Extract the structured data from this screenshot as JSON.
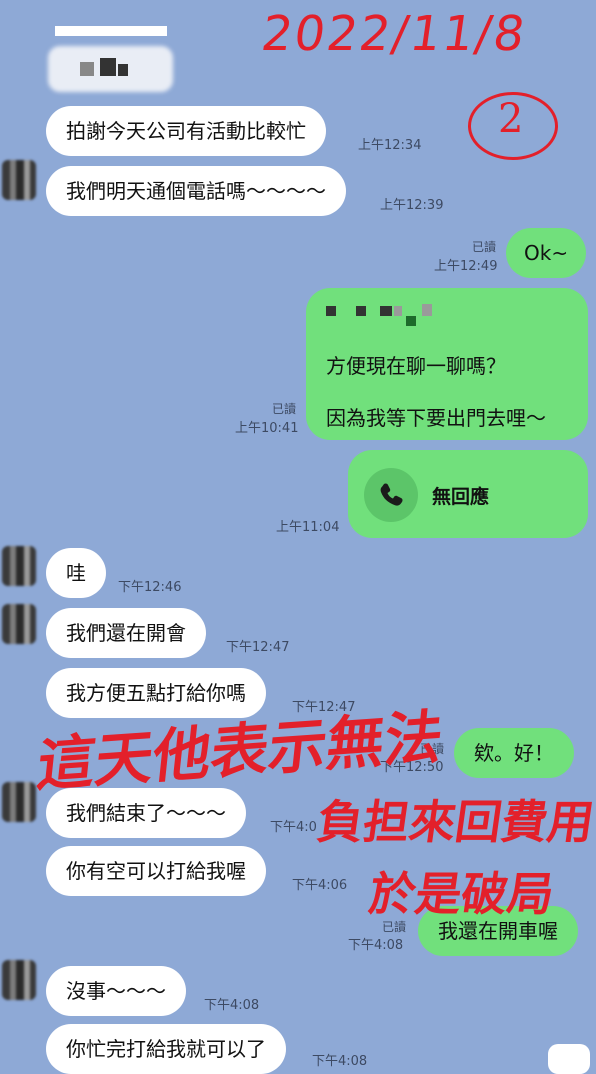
{
  "header": {
    "handwritten_date": "2022/11/8",
    "circled_number": "2"
  },
  "messages": [
    {
      "text": "拍謝今天公司有活動比較忙",
      "time": "上午12:34"
    },
    {
      "text": "我們明天通個電話嗎～～～～",
      "time": "上午12:39"
    },
    {
      "text": "Ok~",
      "time": "上午12:49",
      "read": "已讀"
    },
    {
      "text_line1": "方便現在聊一聊嗎？",
      "text_line2": "因為我等下要出門去哩～",
      "time": "上午10:41",
      "read": "已讀"
    },
    {
      "text": "無回應",
      "time": "上午11:04",
      "icon": "phone-icon"
    },
    {
      "text": "哇",
      "time": "下午12:46"
    },
    {
      "text": "我們還在開會",
      "time": "下午12:47"
    },
    {
      "text": "我方便五點打給你嗎",
      "time": "下午12:47"
    },
    {
      "text": "欸。好！",
      "time": "下午12:50",
      "read": "已讀"
    },
    {
      "text": "我們結束了～～～",
      "time": "下午4:0"
    },
    {
      "text": "你有空可以打給我喔",
      "time": "下午4:06"
    },
    {
      "text": "我還在開車喔",
      "time": "下午4:08",
      "read": "已讀"
    },
    {
      "text": "沒事～～～",
      "time": "下午4:08"
    },
    {
      "text": "你忙完打給我就可以了",
      "time": "下午4:08"
    }
  ],
  "annotation": {
    "line1": "這天他表示無法",
    "line2": "負担來回費用",
    "line3": "於是破局"
  },
  "colors": {
    "background": "#8ea9d6",
    "incoming": "#ffffff",
    "outgoing": "#71e07c",
    "annotation": "#e3202a"
  }
}
